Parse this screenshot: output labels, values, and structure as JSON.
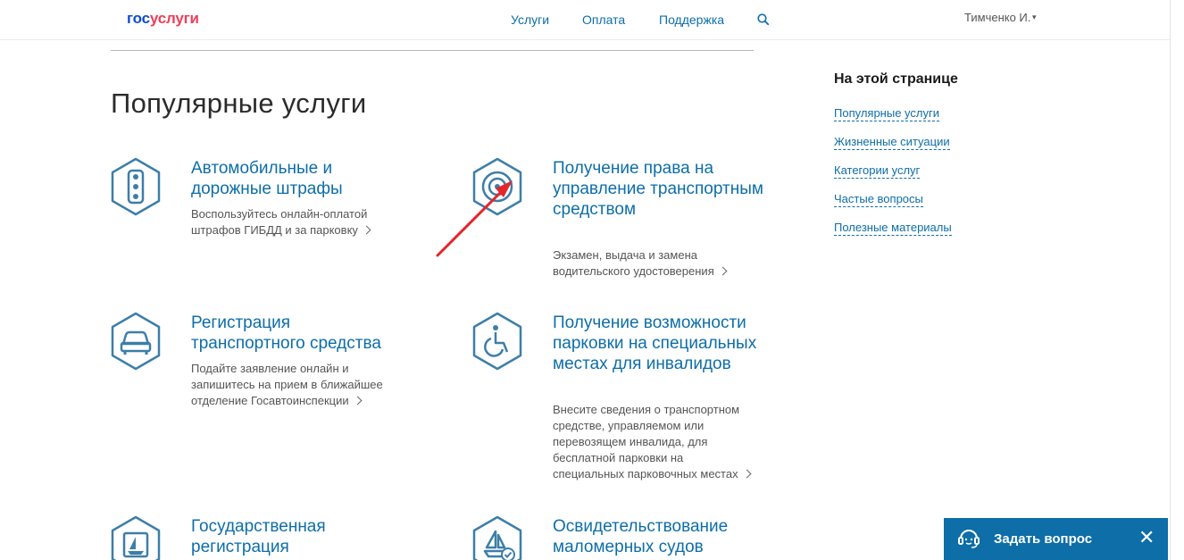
{
  "header": {
    "logo_part1": "гос",
    "logo_part2": "услуги",
    "nav": [
      "Услуги",
      "Оплата",
      "Поддержка"
    ],
    "user": "Тимченко И.",
    "caret": "▾"
  },
  "main": {
    "section_title": "Популярные услуги",
    "cards": [
      {
        "icon": "traffic-light-icon",
        "title": "Автомобильные и дорожные штрафы",
        "desc": [
          "Воспользуйтесь онлайн-оплатой",
          "штрафов ГИБДД и за парковку"
        ]
      },
      {
        "icon": "steering-wheel-icon",
        "title": "Получение права на управление транспортным средством",
        "desc": [
          "Экзамен, выдача и замена",
          "водительского удостоверения"
        ]
      },
      {
        "icon": "car-icon",
        "title": "Регистрация транспортного средства",
        "desc": [
          "Подайте заявление онлайн и",
          "запишитесь на прием в ближайшее",
          "отделение Госавтоинспекции"
        ]
      },
      {
        "icon": "wheelchair-icon",
        "title": "Получение возможности парковки на специальных местах для инвалидов",
        "desc": [
          "Внесите сведения о транспортном",
          "средстве, управляемом или",
          "перевозящем инвалида, для",
          "бесплатной парковки на",
          "специальных парковочных местах"
        ]
      },
      {
        "icon": "boat-icon",
        "title": "Государственная регистрация",
        "desc": []
      },
      {
        "icon": "boat-check-icon",
        "title": "Освидетельствование маломерных судов",
        "desc": []
      }
    ]
  },
  "toc": {
    "title": "На этой странице",
    "links": [
      "Популярные услуги",
      "Жизненные ситуации",
      "Категории услуг",
      "Частые вопросы",
      "Полезные материалы"
    ]
  },
  "chat": {
    "label": "Задать вопрос",
    "close": "✕"
  },
  "colors": {
    "brand_blue": "#0d4cd3",
    "brand_red": "#ee3f58",
    "link_blue": "#0d6ea8",
    "icon_blue": "#3d7ea8",
    "annotation_red": "#e3262b"
  }
}
